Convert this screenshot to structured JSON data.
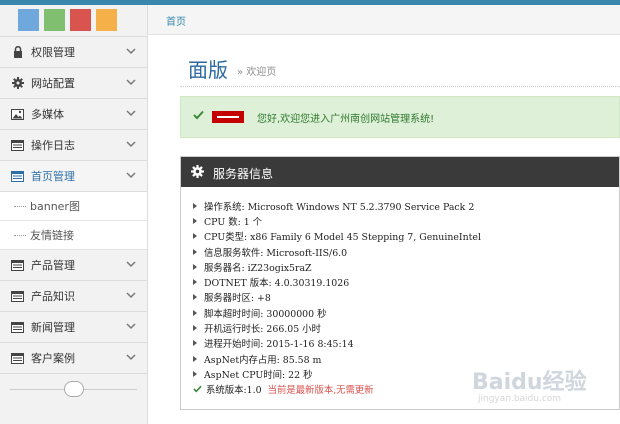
{
  "colors": {
    "swatches": [
      "#6fa8dc",
      "#7fbf6f",
      "#d9534f",
      "#f6b04a"
    ],
    "accent": "#3a87ad",
    "panel_header": "#3a3a3a",
    "success_bg": "#dff0d8"
  },
  "breadcrumb": {
    "home": "首页"
  },
  "header": {
    "title": "面版",
    "subtitle": "» 欢迎页"
  },
  "alert": {
    "message": "您好,欢迎您进入广州南创网站管理系统!"
  },
  "sidebar": {
    "items": [
      {
        "label": "权限管理",
        "icon": "lock-icon"
      },
      {
        "label": "网站配置",
        "icon": "gear-icon"
      },
      {
        "label": "多媒体",
        "icon": "picture-icon"
      },
      {
        "label": "操作日志",
        "icon": "list-icon"
      },
      {
        "label": "首页管理",
        "icon": "list-icon",
        "active": true
      },
      {
        "label": "产品管理",
        "icon": "list-icon"
      },
      {
        "label": "产品知识",
        "icon": "list-icon"
      },
      {
        "label": "新闻管理",
        "icon": "list-icon"
      },
      {
        "label": "客户案例",
        "icon": "list-icon"
      }
    ],
    "subitems": [
      {
        "label": "banner图"
      },
      {
        "label": "友情链接"
      }
    ]
  },
  "panel": {
    "title": "服务器信息",
    "rows": [
      {
        "text": "操作系统: Microsoft Windows NT 5.2.3790 Service Pack 2"
      },
      {
        "text": "CPU 数: 1 个"
      },
      {
        "text": "CPU类型: x86 Family 6 Model 45 Stepping 7, GenuineIntel"
      },
      {
        "text": "信息服务软件: Microsoft-IIS/6.0"
      },
      {
        "text": "服务器名: iZ23ogix5raZ"
      },
      {
        "text": "DOTNET 版本: 4.0.30319.1026"
      },
      {
        "text": "服务器时区: +8"
      },
      {
        "text": "脚本超时时间: 30000000 秒"
      },
      {
        "text": "开机运行时长: 266.05 小时"
      },
      {
        "text": "进程开始时间: 2015-1-16 8:45:14"
      },
      {
        "text": "AspNet内存占用: 85.58 m"
      },
      {
        "text": "AspNet CPU时间: 22 秒"
      }
    ],
    "version": {
      "text": "系统版本:1.0",
      "note": "当前是最新版本,无需更新"
    }
  },
  "watermark": {
    "brand": "Baidu经验",
    "url": "jingyan.baidu.com"
  }
}
